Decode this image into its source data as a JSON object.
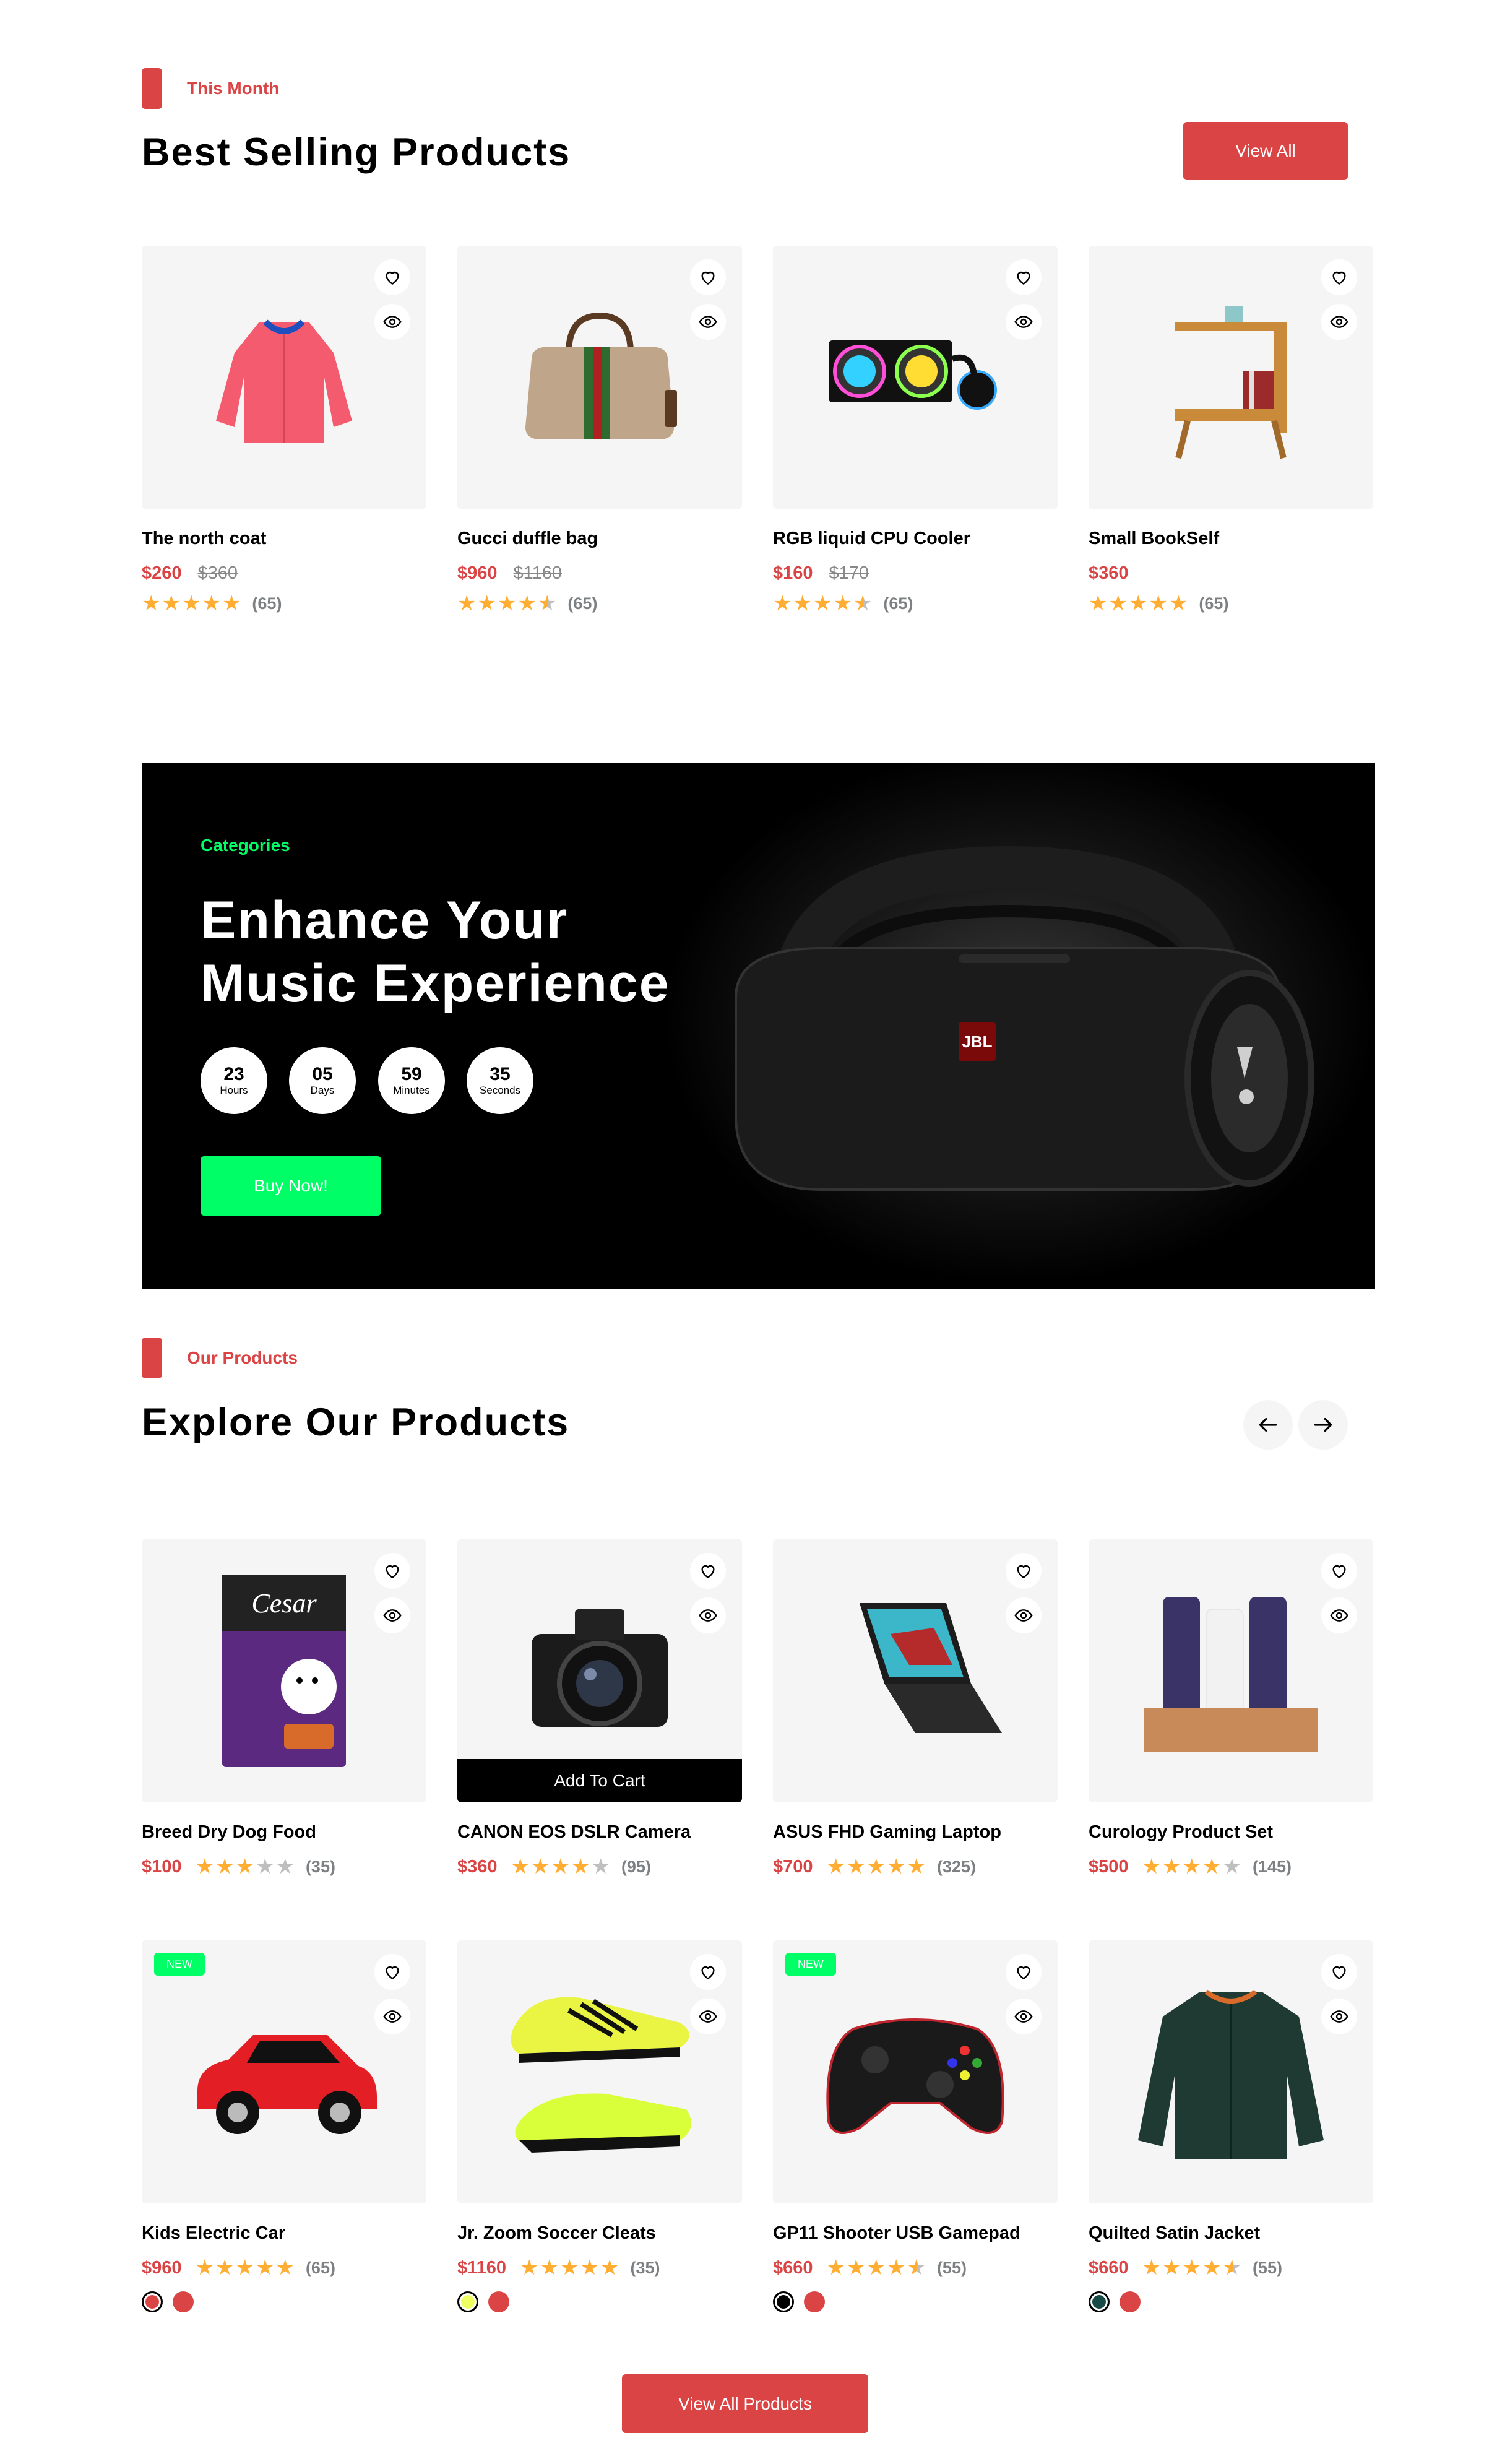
{
  "best_selling": {
    "tag": "This Month",
    "title": "Best Selling Products",
    "view_all": "View All",
    "products": [
      {
        "name": "The north coat",
        "price": "$260",
        "old_price": "$360",
        "rating": 5,
        "reviews": "(65)"
      },
      {
        "name": "Gucci duffle bag",
        "price": "$960",
        "old_price": "$1160",
        "rating": 4.5,
        "reviews": "(65)"
      },
      {
        "name": "RGB liquid CPU Cooler",
        "price": "$160",
        "old_price": "$170",
        "rating": 4.5,
        "reviews": "(65)"
      },
      {
        "name": "Small BookSelf",
        "price": "$360",
        "rating": 5,
        "reviews": "(65)"
      }
    ]
  },
  "banner": {
    "category": "Categories",
    "title_line1": "Enhance Your",
    "title_line2": "Music Experience",
    "timer": [
      {
        "value": "23",
        "label": "Hours"
      },
      {
        "value": "05",
        "label": "Days"
      },
      {
        "value": "59",
        "label": "Minutes"
      },
      {
        "value": "35",
        "label": "Seconds"
      }
    ],
    "button": "Buy Now!",
    "speaker_logo": "JBL"
  },
  "explore": {
    "tag": "Our Products",
    "title": "Explore Our Products",
    "add_to_cart": "Add To Cart",
    "new_badge": "NEW",
    "view_all_products": "View All Products",
    "products": [
      {
        "name": "Breed Dry Dog Food",
        "price": "$100",
        "rating": 3,
        "reviews": "(35)",
        "package_brand": "Cesar"
      },
      {
        "name": "CANON EOS DSLR Camera",
        "price": "$360",
        "rating": 4,
        "reviews": "(95)"
      },
      {
        "name": "ASUS FHD Gaming Laptop",
        "price": "$700",
        "rating": 5,
        "reviews": "(325)"
      },
      {
        "name": "Curology Product Set",
        "price": "$500",
        "rating": 4,
        "reviews": "(145)"
      },
      {
        "name": "Kids Electric Car",
        "price": "$960",
        "rating": 5,
        "reviews": "(65)",
        "colors": [
          "#DB4444",
          "#DB4444"
        ]
      },
      {
        "name": "Jr. Zoom Soccer Cleats",
        "price": "$1160",
        "rating": 5,
        "reviews": "(35)",
        "colors": [
          "#EEFF61",
          "#DB4444"
        ]
      },
      {
        "name": "GP11 Shooter USB Gamepad",
        "price": "$660",
        "rating": 4.5,
        "reviews": "(55)",
        "colors": [
          "#000000",
          "#DB4444"
        ]
      },
      {
        "name": "Quilted Satin Jacket",
        "price": "$660",
        "rating": 4.5,
        "reviews": "(55)",
        "colors": [
          "#184A48",
          "#DB4444"
        ]
      }
    ]
  },
  "colors": {
    "accent": "#DB4444",
    "green": "#00FF66",
    "card_bg": "#F5F5F5",
    "star": "#FFAD33"
  }
}
